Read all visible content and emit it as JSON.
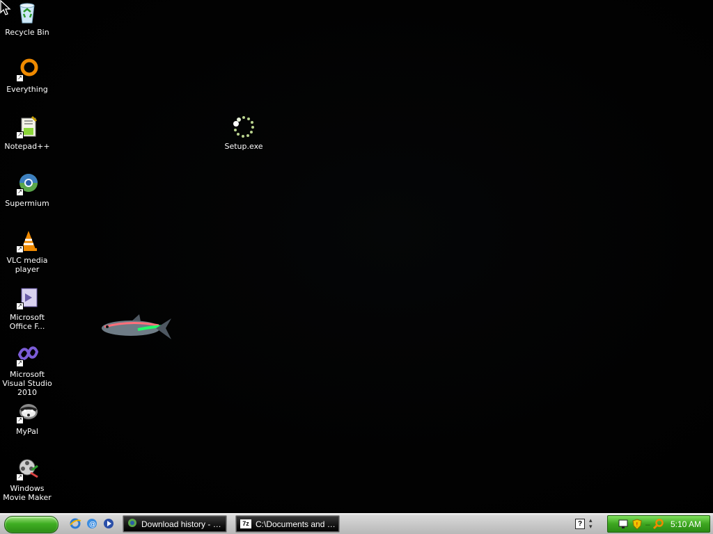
{
  "desktop": {
    "icons": [
      {
        "label": "Recycle Bin",
        "icon": "recycle-bin-icon",
        "shortcut": false
      },
      {
        "label": "Everything",
        "icon": "everything-icon",
        "shortcut": true
      },
      {
        "label": "Notepad++",
        "icon": "notepad-plus-plus-icon",
        "shortcut": true
      },
      {
        "label": "Supermium",
        "icon": "supermium-icon",
        "shortcut": true
      },
      {
        "label": "VLC media player",
        "icon": "vlc-icon",
        "shortcut": true
      },
      {
        "label": "Microsoft Office F...",
        "icon": "office-icon",
        "shortcut": true
      },
      {
        "label": "Microsoft Visual Studio 2010",
        "icon": "visual-studio-icon",
        "shortcut": true
      },
      {
        "label": "MyPal",
        "icon": "mypal-icon",
        "shortcut": true
      },
      {
        "label": "Windows Movie Maker",
        "icon": "movie-maker-icon",
        "shortcut": true
      }
    ],
    "setup": {
      "label": "Setup.exe",
      "icon": "setup-loading-icon"
    }
  },
  "taskbar": {
    "quick_launch": [
      "internet-explorer-icon",
      "email-icon",
      "media-player-icon"
    ],
    "tasks": [
      {
        "label": "Download history - S...",
        "icon": "supermium-icon"
      },
      {
        "label": "C:\\Documents and S...",
        "icon": "7zip-icon",
        "icon_text": "7z"
      }
    ],
    "clock": "5:10 AM"
  },
  "colors": {
    "start": "#3fae22",
    "tray": "#3da620",
    "taskbar": "#c9c9c9"
  }
}
